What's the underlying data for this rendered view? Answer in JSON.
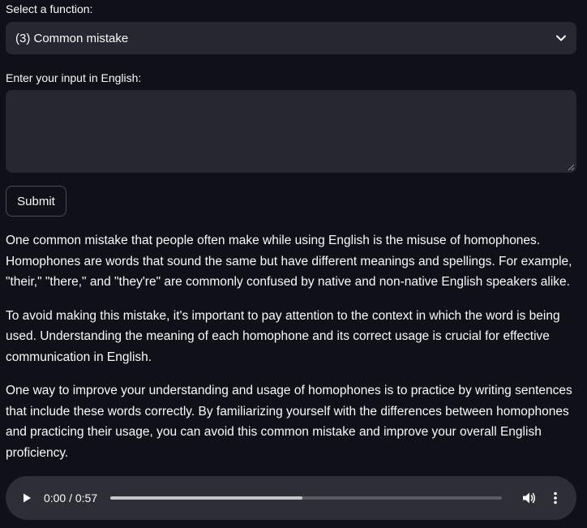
{
  "form": {
    "select_label": "Select a function:",
    "select_value": "(3) Common mistake",
    "input_label": "Enter your input in English:",
    "input_value": "",
    "submit_label": "Submit"
  },
  "output": {
    "paragraphs": [
      "One common mistake that people often make while using English is the misuse of homophones. Homophones are words that sound the same but have different meanings and spellings. For example, \"their,\" \"there,\" and \"they're\" are commonly confused by native and non-native English speakers alike.",
      "To avoid making this mistake, it's important to pay attention to the context in which the word is being used. Understanding the meaning of each homophone and its correct usage is crucial for effective communication in English.",
      "One way to improve your understanding and usage of homophones is to practice by writing sentences that include these words correctly. By familiarizing yourself with the differences between homophones and practicing their usage, you can avoid this common mistake and improve your overall English proficiency."
    ]
  },
  "audio": {
    "time_display": "0:00 / 0:57",
    "progress_fraction": 0.49
  },
  "icons": {
    "dropdown": "chevron-down-icon",
    "play": "play-icon",
    "volume": "volume-icon",
    "more": "more-vertical-icon"
  },
  "colors": {
    "background": "#0e1117",
    "field": "#262730",
    "text": "#fafafa",
    "player": "#2e2f36"
  }
}
